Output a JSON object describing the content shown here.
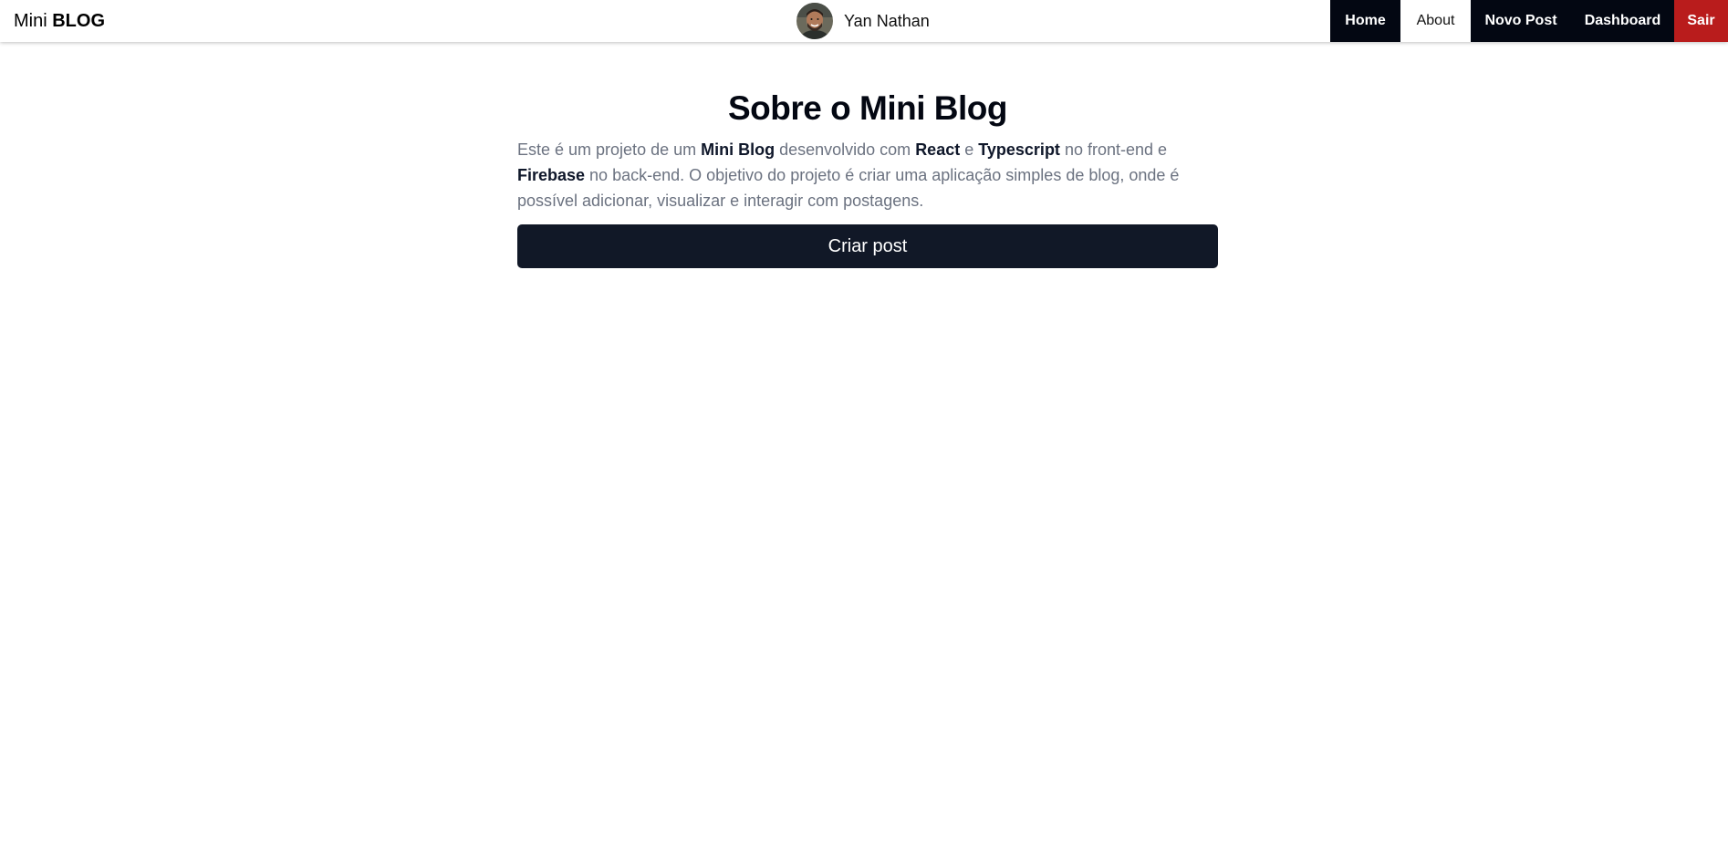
{
  "navbar": {
    "brand_prefix": "Mini",
    "brand_bold": "BLOG",
    "user_name": "Yan Nathan",
    "links": [
      {
        "label": "Home"
      },
      {
        "label": "About"
      },
      {
        "label": "Novo Post"
      },
      {
        "label": "Dashboard"
      },
      {
        "label": "Sair"
      }
    ],
    "active_link": "About"
  },
  "about": {
    "title": "Sobre o Mini Blog",
    "paragraph": {
      "t1": "Este é um projeto de um ",
      "b1": "Mini Blog",
      "t2": " desenvolvido com ",
      "b2": "React",
      "t3": " e ",
      "b3": "Typescript",
      "t4": " no front-end e ",
      "b4": "Firebase",
      "t5": " no back-end. O objetivo do projeto é criar uma aplicação simples de blog, onde é possível adicionar, visualizar e interagir com postagens."
    },
    "button_label": "Criar post"
  },
  "colors": {
    "nav_dark": "#030712",
    "logout_red": "#b91c1c",
    "button_dark": "#111827",
    "text_muted": "#6b7280"
  }
}
